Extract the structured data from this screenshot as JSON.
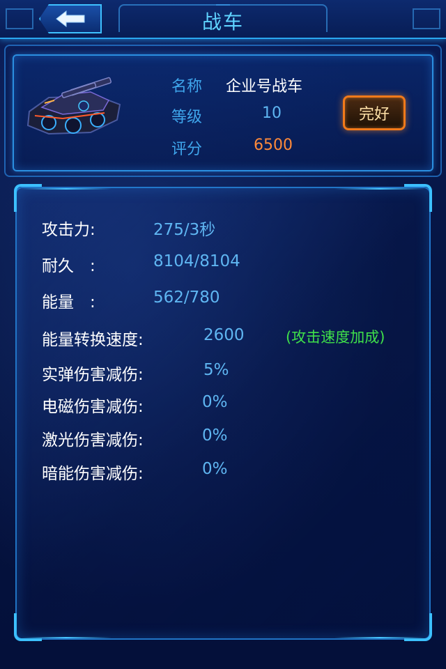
{
  "header": {
    "title": "战车",
    "back_icon": "back-arrow-icon"
  },
  "info": {
    "name_label": "名称",
    "name_value": "企业号战车",
    "level_label": "等级",
    "level_value": "10",
    "score_label": "评分",
    "score_value": "6500",
    "status_button": "完好",
    "colors": {
      "label": "#3fa6ec",
      "name": "#ffffff",
      "level": "#5fb6f2",
      "score": "#ff8a3a",
      "status_border": "#f27a1a"
    }
  },
  "stats": {
    "attack_label": "攻击力:",
    "attack_value": "275/3秒",
    "durability_label": "耐久　:",
    "durability_value": "8104/8104",
    "energy_label": "能量　:",
    "energy_value": "562/780",
    "conversion_label": "能量转换速度:",
    "conversion_value": "2600",
    "conversion_note": "(攻击速度加成)",
    "kinetic_label": "实弹伤害减伤:",
    "kinetic_value": "5%",
    "em_label": "电磁伤害减伤:",
    "em_value": "0%",
    "laser_label": "激光伤害减伤:",
    "laser_value": "0%",
    "dark_label": "暗能伤害减伤:",
    "dark_value": "0%",
    "colors": {
      "label": "#ffffff",
      "value": "#5fb6f2",
      "note": "#3fe04a"
    }
  }
}
